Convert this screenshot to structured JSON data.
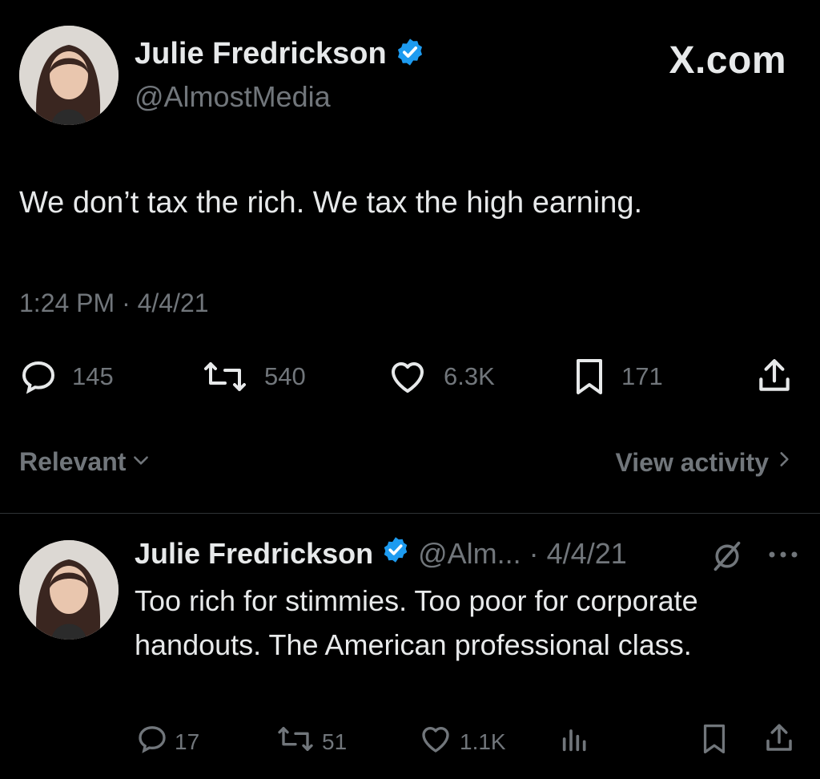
{
  "brand": {
    "logo_text": "X.com"
  },
  "tweet": {
    "author_name": "Julie Fredrickson",
    "author_handle": "@AlmostMedia",
    "text": "We don’t tax the rich. We tax the high earning.",
    "timestamp": "1:24 PM · 4/4/21",
    "stats": {
      "replies": "145",
      "reposts": "540",
      "likes": "6.3K",
      "bookmarks": "171"
    }
  },
  "filter": {
    "sort_label": "Relevant",
    "activity_label": "View activity"
  },
  "reply": {
    "author_name": "Julie Fredrickson",
    "author_handle_date": "@Alm... · 4/4/21",
    "text": "Too rich for stimmies. Too poor for corporate handouts. The American professional class.",
    "stats": {
      "replies": "17",
      "reposts": "51",
      "likes": "1.1K"
    }
  },
  "colors": {
    "background": "#000000",
    "text": "#e7e9ea",
    "muted": "#71767b",
    "verified": "#1d9bf0",
    "divider": "#2f3336"
  }
}
